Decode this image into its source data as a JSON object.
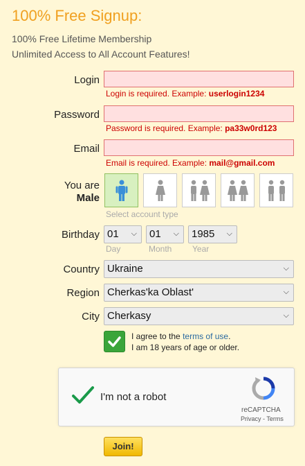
{
  "header": {
    "title": "100% Free Signup:",
    "line1": "100% Free Lifetime Membership",
    "line2": "Unlimited Access to All Account Features!"
  },
  "login": {
    "label": "Login",
    "value": "",
    "error_prefix": "Login is required. Example: ",
    "error_example": "userlogin1234"
  },
  "password": {
    "label": "Password",
    "value": "",
    "error_prefix": "Password is required. Example: ",
    "error_example": "pa33w0rd123"
  },
  "email": {
    "label": "Email",
    "value": "",
    "error_prefix": "Email is required. Example: ",
    "error_example": "mail@gmail.com"
  },
  "account_type": {
    "label": "You are",
    "selected": "Male",
    "hint": "Select account type",
    "options": [
      "male-icon",
      "female-icon",
      "couple-male-female-icon",
      "couple-female-female-icon",
      "couple-male-male-icon"
    ]
  },
  "birthday": {
    "label": "Birthday",
    "day": "01",
    "month": "01",
    "year": "1985",
    "day_hint": "Day",
    "month_hint": "Month",
    "year_hint": "Year"
  },
  "location": {
    "country_label": "Country",
    "country": "Ukraine",
    "region_label": "Region",
    "region": "Cherkas'ka Oblast'",
    "city_label": "City",
    "city": "Cherkasy"
  },
  "agreement": {
    "checked": true,
    "text_before": "I agree to the ",
    "link": "terms of use",
    "text_after": ".",
    "line2": "I am 18 years of age or older."
  },
  "captcha": {
    "label": "I'm not a robot",
    "brand": "reCAPTCHA",
    "privacy": "Privacy",
    "sep": " - ",
    "terms": "Terms"
  },
  "submit": {
    "label": "Join!"
  },
  "colors": {
    "background": "#fff7d6",
    "title": "#f0a020",
    "error": "#cc0000",
    "selected_tile": "#d8f0c0",
    "join_button": "#f0b800"
  }
}
